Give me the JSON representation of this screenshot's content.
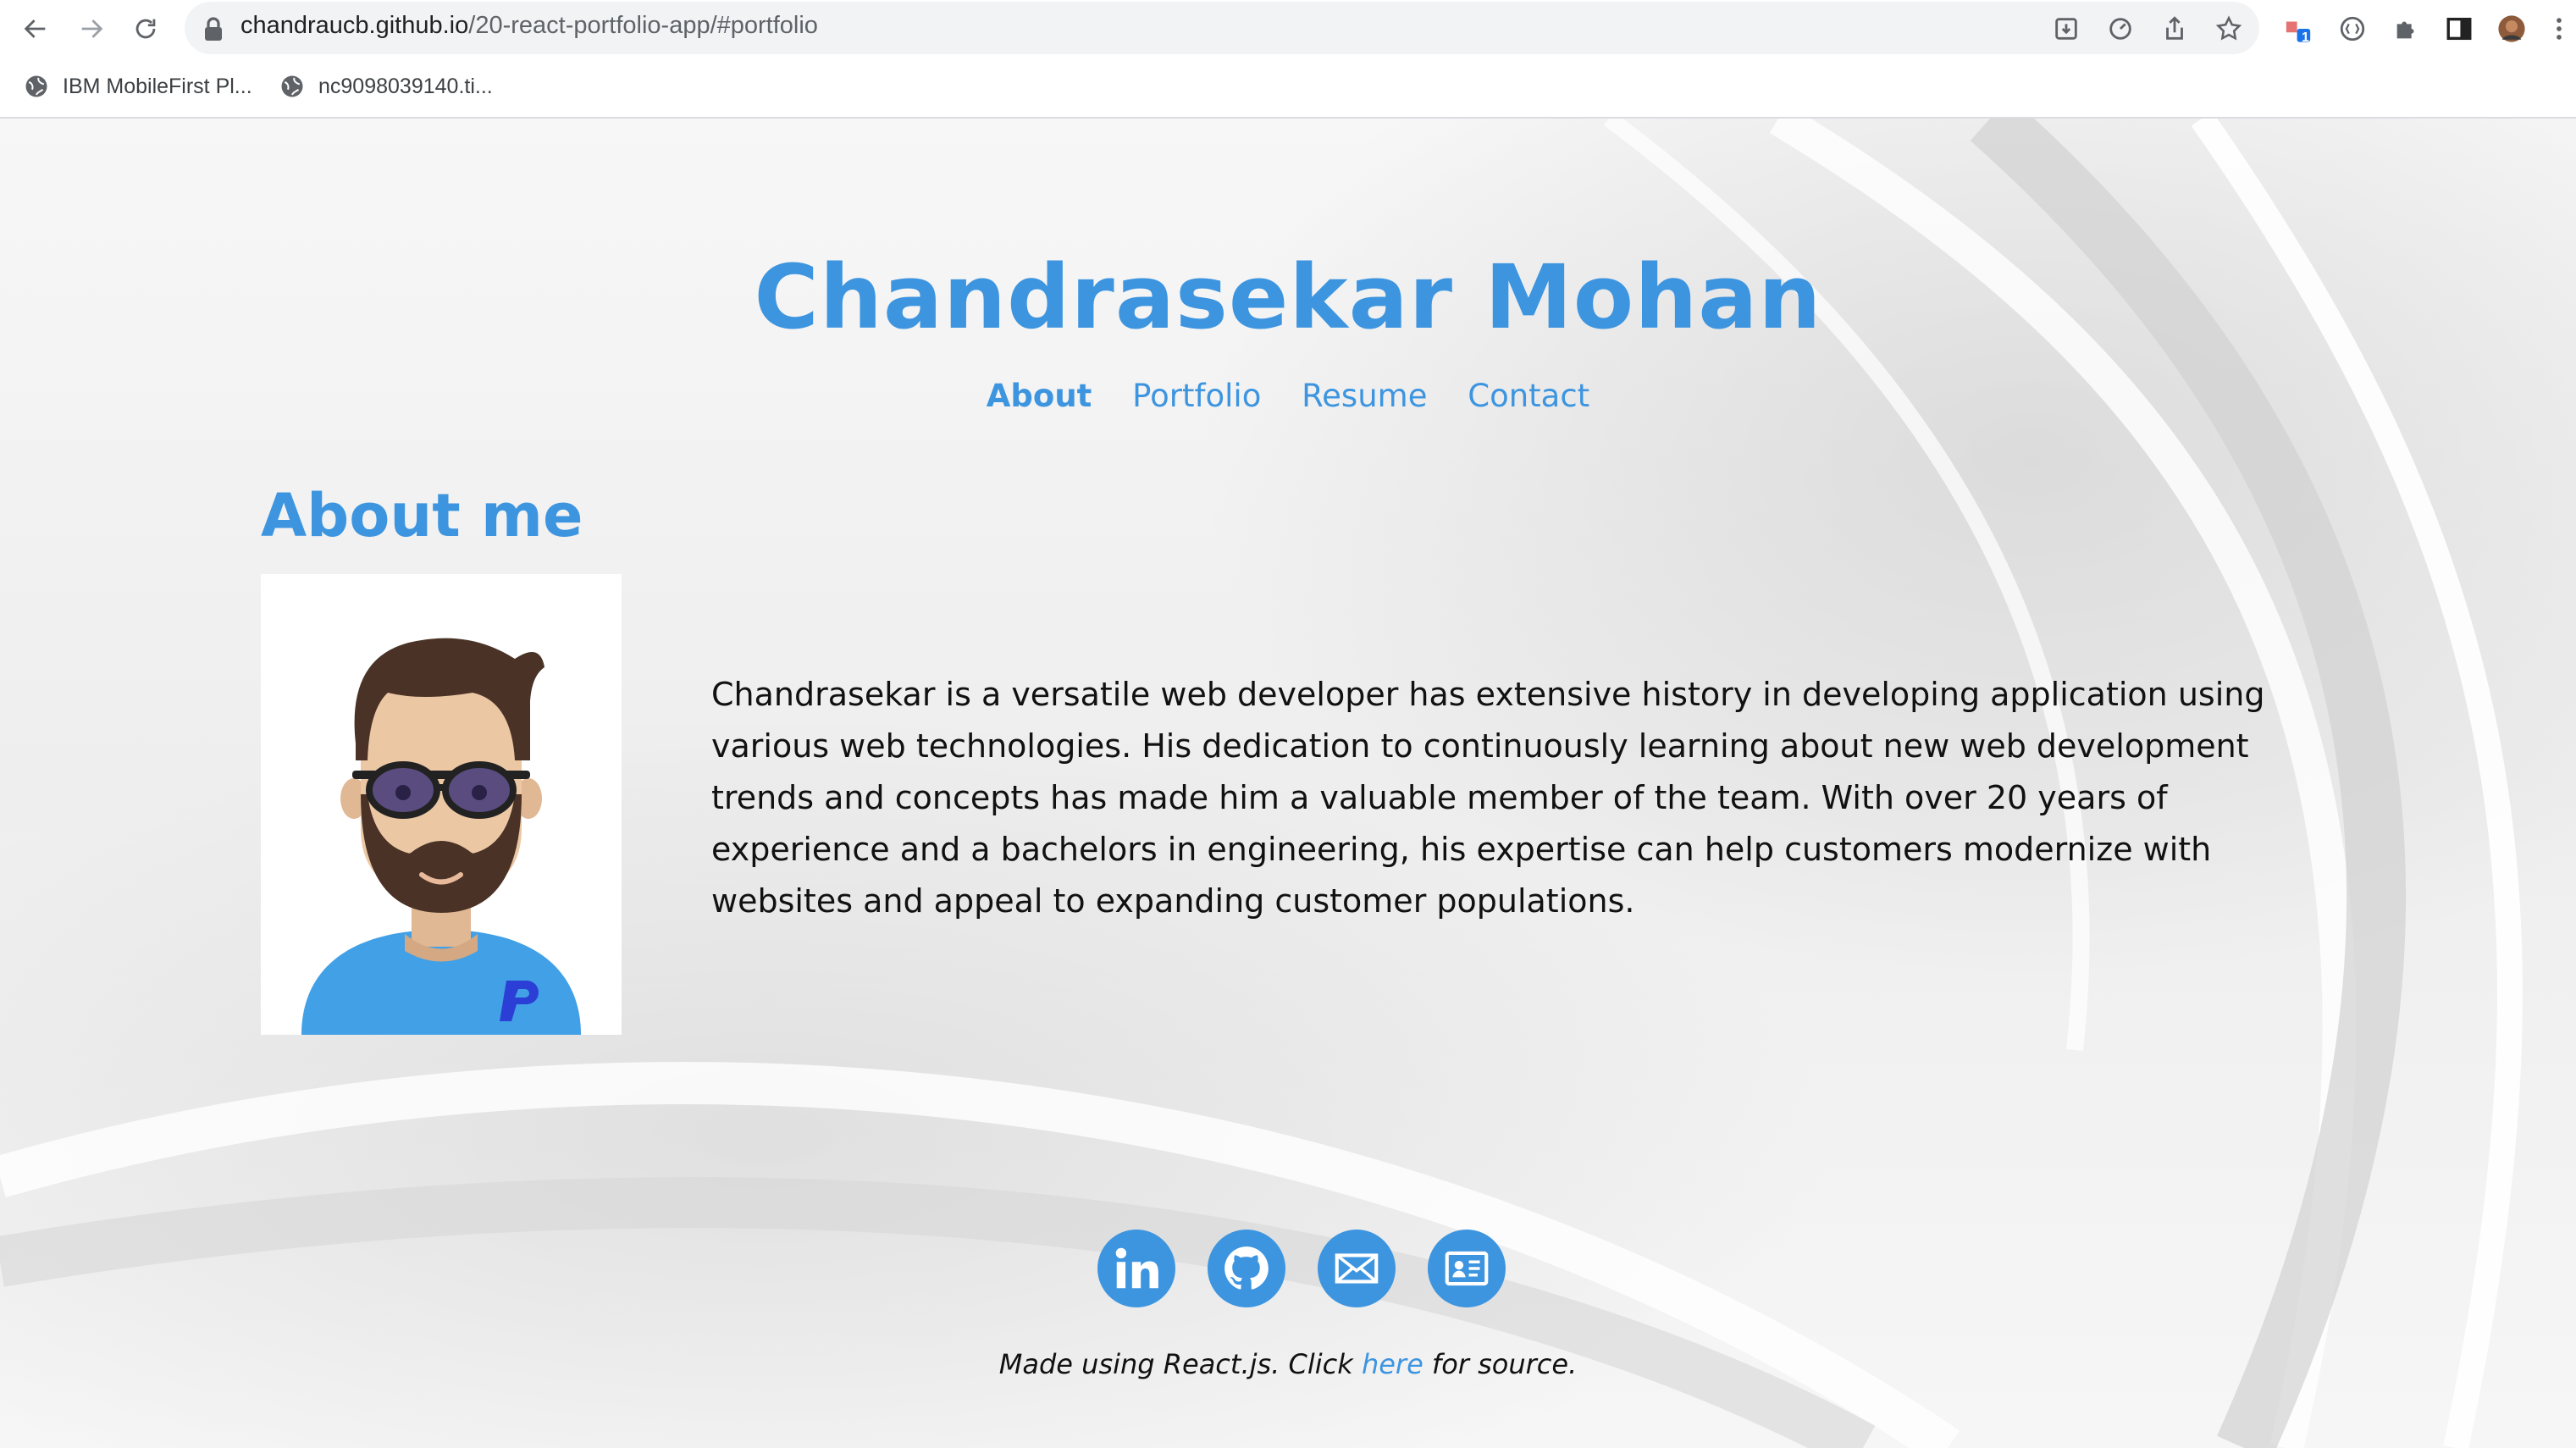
{
  "browser": {
    "url_host": "chandraucb.github.io",
    "url_path": "/20-react-portfolio-app/#portfolio",
    "extension_badge": "1",
    "bookmarks": [
      {
        "label": "IBM MobileFirst Pl...",
        "icon": "globe-icon"
      },
      {
        "label": "nc9098039140.ti...",
        "icon": "globe-icon"
      }
    ]
  },
  "site": {
    "title": "Chandrasekar Mohan",
    "nav": [
      {
        "label": "About",
        "active": true
      },
      {
        "label": "Portfolio",
        "active": false
      },
      {
        "label": "Resume",
        "active": false
      },
      {
        "label": "Contact",
        "active": false
      }
    ]
  },
  "about": {
    "heading": "About me",
    "avatar_alt": "cartoon avatar with beard and sunglasses",
    "paragraph": "Chandrasekar is a versatile web developer has extensive history in developing application using various web technologies. His dedication to continuously learning about new web development trends and concepts has made him a valuable member of the team. With over 20 years of experience and a bachelors in engineering, his expertise can help customers modernize with websites and appeal to expanding customer populations."
  },
  "social": [
    {
      "name": "linkedin",
      "icon": "linkedin-icon"
    },
    {
      "name": "github",
      "icon": "github-icon"
    },
    {
      "name": "email",
      "icon": "mail-icon"
    },
    {
      "name": "resume",
      "icon": "id-card-icon"
    }
  ],
  "footer": {
    "prefix": "Made using React.js. Click ",
    "link_text": "here",
    "suffix": " for source."
  },
  "colors": {
    "accent": "#3d95e0",
    "text": "#111111",
    "chrome_bg": "#f1f3f4"
  }
}
